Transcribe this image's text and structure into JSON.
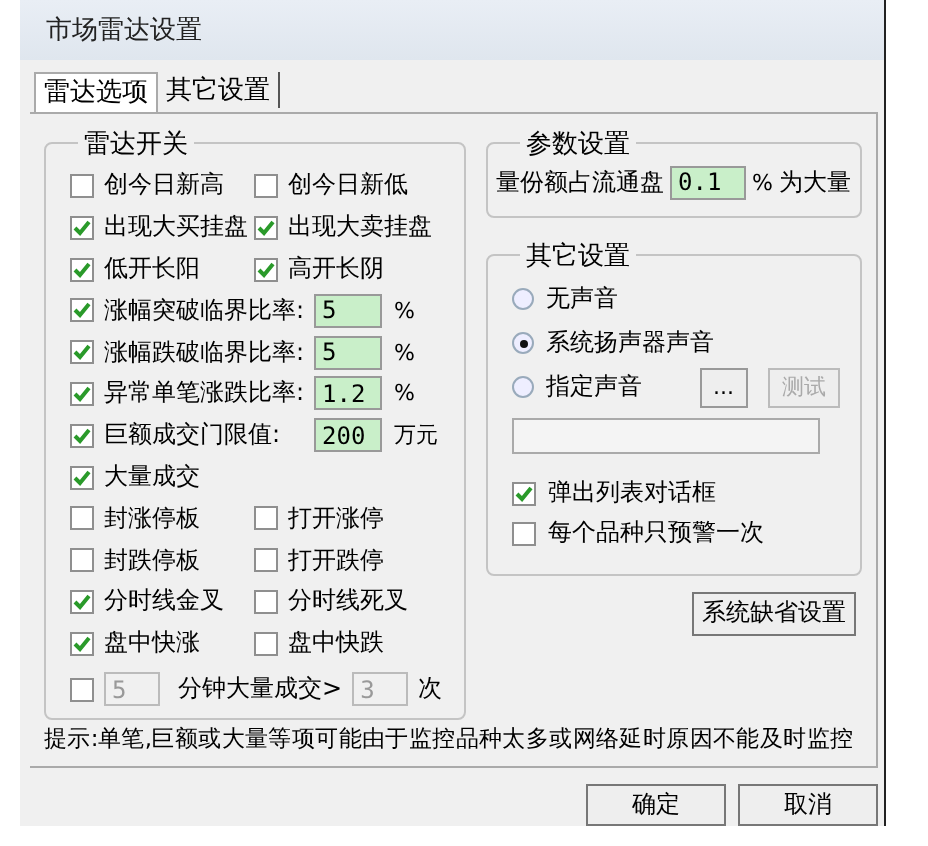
{
  "window": {
    "title": "市场雷达设置"
  },
  "tabs": [
    {
      "label": "雷达选项",
      "selected": true
    },
    {
      "label": "其它设置",
      "selected": false
    }
  ],
  "radar_switches": {
    "title": "雷达开关",
    "rows": [
      {
        "kind": "pair",
        "items": [
          {
            "label": "创今日新高",
            "checked": false
          },
          {
            "label": "创今日新低",
            "checked": false
          }
        ]
      },
      {
        "kind": "pair",
        "items": [
          {
            "label": "出现大买挂盘",
            "checked": true
          },
          {
            "label": "出现大卖挂盘",
            "checked": true
          }
        ]
      },
      {
        "kind": "pair",
        "items": [
          {
            "label": "低开长阳",
            "checked": true
          },
          {
            "label": "高开长阴",
            "checked": true
          }
        ]
      },
      {
        "kind": "field",
        "label": "涨幅突破临界比率:",
        "checked": true,
        "value": "5",
        "unit": "%"
      },
      {
        "kind": "field",
        "label": "涨幅跌破临界比率:",
        "checked": true,
        "value": "5",
        "unit": "%"
      },
      {
        "kind": "field",
        "label": "异常单笔涨跌比率:",
        "checked": true,
        "value": "1.2",
        "unit": "%"
      },
      {
        "kind": "field",
        "label": "巨额成交门限值:",
        "checked": true,
        "value": "200",
        "unit": "万元"
      },
      {
        "kind": "pair",
        "items": [
          {
            "label": "大量成交",
            "checked": true
          }
        ]
      },
      {
        "kind": "pair",
        "items": [
          {
            "label": "封涨停板",
            "checked": false
          },
          {
            "label": "打开涨停",
            "checked": false
          }
        ]
      },
      {
        "kind": "pair",
        "items": [
          {
            "label": "封跌停板",
            "checked": false
          },
          {
            "label": "打开跌停",
            "checked": false
          }
        ]
      },
      {
        "kind": "pair",
        "items": [
          {
            "label": "分时线金叉",
            "checked": true
          },
          {
            "label": "分时线死叉",
            "checked": false
          }
        ]
      },
      {
        "kind": "pair",
        "items": [
          {
            "label": "盘中快涨",
            "checked": true
          },
          {
            "label": "盘中快跌",
            "checked": false
          }
        ]
      },
      {
        "kind": "minutes",
        "checked": false,
        "value": "5",
        "label": "分钟大量成交>",
        "value_2": "3",
        "unit": "次"
      }
    ]
  },
  "parameters": {
    "title": "参数设置",
    "label": "量份额占流通盘",
    "value": "0.1",
    "unit": "%",
    "suffix": "为大量"
  },
  "other_settings": {
    "title": "其它设置",
    "radios": [
      {
        "label": "无声音",
        "selected": false
      },
      {
        "label": "系统扬声器声音",
        "selected": true
      },
      {
        "label": "指定声音",
        "selected": false
      }
    ],
    "browse_button": "...",
    "test_button": {
      "label": "测试",
      "disabled": true
    },
    "checkboxes": [
      {
        "label": "弹出列表对话框",
        "checked": true
      },
      {
        "label": "每个品种只预警一次",
        "checked": false
      }
    ]
  },
  "defaults_button": "系统缺省设置",
  "hint": "提示:单笔,巨额或大量等项可能由于监控品种太多或网络延时原因不能及时监控",
  "buttons": [
    "确定",
    "取消"
  ]
}
